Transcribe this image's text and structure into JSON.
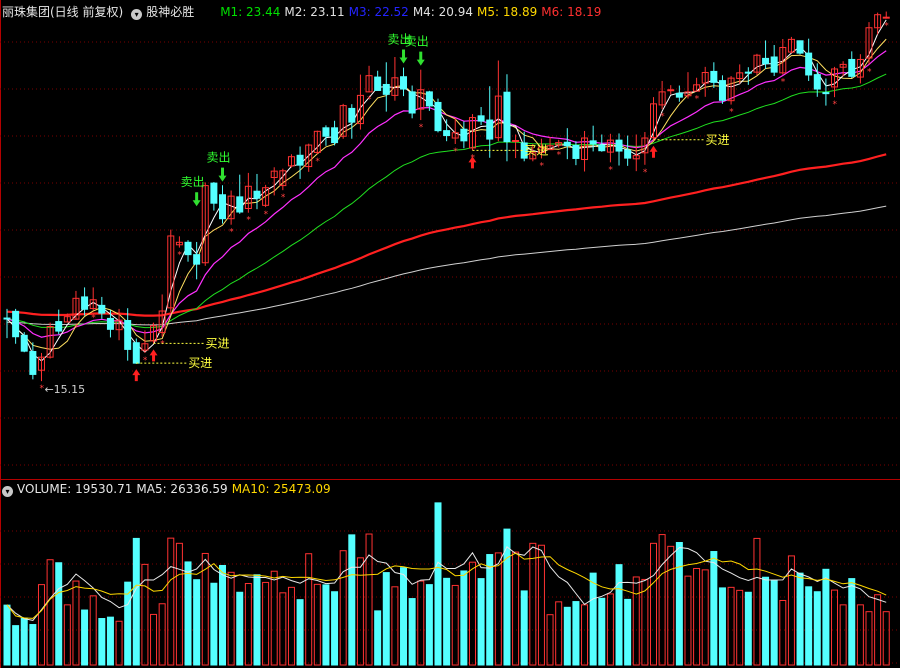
{
  "header": {
    "stock_title": "丽珠集团(日线 前复权)",
    "indicator_name": "股神必胜",
    "ma_labels": [
      {
        "text": "M1: 23.44",
        "color": "#00e000"
      },
      {
        "text": "M2: 23.11",
        "color": "#e0e0e0"
      },
      {
        "text": "M3: 22.52",
        "color": "#2424ff"
      },
      {
        "text": "M4: 20.94",
        "color": "#e0e0e0"
      },
      {
        "text": "M5: 18.89",
        "color": "#ffd800"
      },
      {
        "text": "M6: 18.19",
        "color": "#ff3030"
      }
    ]
  },
  "volume_header": {
    "volume": "VOLUME: 19530.71",
    "ma5": "MA5: 26336.59",
    "ma10": "MA10: 25473.09"
  },
  "colors": {
    "up": "#ff3232",
    "down": "#54ffff",
    "grid": "#7a0000",
    "buy_text": "#ffff40",
    "sell_text": "#30ff30"
  },
  "chart_data": [
    {
      "type": "candlestick",
      "price_range": [
        12.9,
        25.9
      ],
      "min_label": "15.15",
      "candles": [
        [
          17.44,
          17.42,
          17.7,
          16.87
        ],
        [
          17.63,
          16.91,
          17.7,
          16.71
        ],
        [
          16.95,
          16.5,
          17.04,
          16.47
        ],
        [
          16.49,
          15.84,
          16.75,
          15.7
        ],
        [
          15.96,
          16.33,
          16.45,
          15.65
        ],
        [
          16.33,
          17.2,
          17.31,
          16.29
        ],
        [
          17.34,
          17.07,
          17.68,
          16.98
        ],
        [
          17.33,
          17.48,
          17.57,
          17.31
        ],
        [
          17.41,
          18.0,
          18.21,
          17.39
        ],
        [
          18.04,
          17.69,
          18.31,
          17.51
        ],
        [
          17.71,
          17.96,
          18.31,
          17.66
        ],
        [
          17.8,
          17.58,
          18.04,
          17.42
        ],
        [
          17.43,
          17.12,
          17.67,
          16.89
        ],
        [
          17.11,
          17.38,
          17.7,
          16.81
        ],
        [
          17.37,
          16.55,
          17.72,
          16.23
        ],
        [
          16.74,
          16.16,
          16.86,
          16.14
        ],
        [
          16.53,
          16.71,
          17.09,
          16.45
        ],
        [
          16.79,
          17.22,
          17.31,
          16.72
        ],
        [
          17.03,
          17.64,
          18.11,
          16.91
        ],
        [
          17.73,
          19.77,
          19.95,
          17.61
        ],
        [
          19.52,
          19.59,
          19.76,
          19.44
        ],
        [
          19.59,
          19.24,
          19.65,
          19.04
        ],
        [
          19.24,
          18.97,
          19.6,
          18.54
        ],
        [
          19.01,
          21.2,
          21.29,
          18.92
        ],
        [
          21.27,
          20.7,
          21.3,
          20.49
        ],
        [
          20.94,
          20.26,
          21.21,
          20.12
        ],
        [
          20.26,
          20.9,
          21.06,
          20.09
        ],
        [
          20.88,
          20.45,
          21.51,
          20.4
        ],
        [
          20.55,
          21.18,
          21.56,
          20.43
        ],
        [
          21.04,
          20.84,
          21.53,
          20.53
        ],
        [
          20.64,
          21.14,
          21.22,
          20.59
        ],
        [
          21.43,
          21.61,
          21.72,
          20.92
        ],
        [
          21.2,
          21.62,
          21.68,
          21.07
        ],
        [
          21.76,
          22.02,
          22.09,
          21.71
        ],
        [
          22.06,
          21.78,
          22.31,
          21.39
        ],
        [
          21.74,
          22.35,
          22.39,
          21.59
        ],
        [
          22.14,
          22.74,
          22.76,
          22.09
        ],
        [
          22.84,
          22.6,
          22.91,
          22.33
        ],
        [
          22.84,
          22.42,
          23.04,
          22.34
        ],
        [
          22.6,
          23.47,
          23.52,
          22.53
        ],
        [
          23.39,
          23.0,
          23.51,
          22.53
        ],
        [
          22.96,
          23.76,
          24.35,
          22.79
        ],
        [
          23.86,
          24.32,
          24.6,
          23.85
        ],
        [
          24.28,
          23.9,
          24.46,
          23.9
        ],
        [
          24.07,
          23.79,
          24.7,
          23.3
        ],
        [
          23.76,
          24.26,
          24.85,
          23.61
        ],
        [
          24.29,
          23.94,
          24.55,
          23.74
        ],
        [
          23.86,
          23.26,
          24.04,
          23.11
        ],
        [
          23.37,
          23.92,
          24.49,
          23.06
        ],
        [
          23.86,
          23.46,
          23.89,
          23.32
        ],
        [
          23.56,
          22.76,
          23.67,
          22.71
        ],
        [
          22.76,
          22.62,
          23.08,
          22.46
        ],
        [
          22.55,
          22.7,
          23.12,
          22.38
        ],
        [
          22.8,
          22.47,
          23.02,
          22.26
        ],
        [
          22.27,
          23.13,
          23.23,
          22.2
        ],
        [
          23.18,
          23.03,
          23.43,
          22.92
        ],
        [
          23.06,
          22.52,
          24.02,
          21.99
        ],
        [
          22.56,
          23.74,
          24.75,
          22.46
        ],
        [
          23.85,
          22.45,
          24.36,
          21.89
        ],
        [
          22.46,
          22.48,
          22.65,
          21.98
        ],
        [
          22.41,
          21.98,
          22.73,
          21.89
        ],
        [
          21.96,
          22.13,
          22.38,
          21.89
        ],
        [
          22.14,
          22.29,
          22.53,
          21.97
        ],
        [
          22.22,
          22.33,
          22.58,
          22.21
        ],
        [
          22.35,
          22.42,
          22.5,
          22.28
        ],
        [
          22.43,
          22.33,
          22.83,
          21.95
        ],
        [
          22.34,
          21.97,
          22.46,
          21.78
        ],
        [
          21.94,
          22.55,
          22.75,
          21.6
        ],
        [
          22.47,
          22.38,
          22.9,
          22.17
        ],
        [
          22.35,
          22.19,
          22.65,
          22.16
        ],
        [
          22.15,
          22.49,
          22.67,
          21.86
        ],
        [
          22.49,
          22.18,
          22.68,
          21.77
        ],
        [
          22.21,
          21.98,
          22.62,
          21.76
        ],
        [
          21.96,
          22.05,
          22.65,
          21.61
        ],
        [
          22.13,
          22.55,
          22.72,
          21.79
        ],
        [
          22.56,
          23.52,
          23.71,
          22.5
        ],
        [
          23.49,
          23.86,
          24.17,
          23.37
        ],
        [
          23.9,
          23.92,
          24.05,
          23.79
        ],
        [
          23.82,
          23.71,
          24.04,
          23.58
        ],
        [
          23.75,
          23.86,
          24.42,
          23.67
        ],
        [
          23.88,
          24.06,
          24.26,
          23.87
        ],
        [
          24.11,
          24.41,
          24.57,
          23.72
        ],
        [
          24.44,
          24.13,
          24.7,
          23.97
        ],
        [
          24.18,
          23.62,
          24.33,
          23.52
        ],
        [
          23.61,
          24.25,
          24.31,
          23.5
        ],
        [
          24.24,
          24.4,
          24.64,
          24.09
        ],
        [
          24.42,
          24.41,
          24.56,
          24.06
        ],
        [
          24.42,
          24.9,
          24.94,
          24.34
        ],
        [
          24.81,
          24.66,
          25.32,
          24.51
        ],
        [
          24.85,
          24.42,
          25.19,
          24.31
        ],
        [
          24.4,
          25.12,
          25.36,
          24.35
        ],
        [
          24.99,
          25.35,
          25.42,
          24.96
        ],
        [
          25.31,
          24.96,
          25.32,
          24.92
        ],
        [
          24.96,
          24.34,
          25.37,
          24.17
        ],
        [
          24.35,
          23.94,
          24.67,
          23.72
        ],
        [
          23.84,
          23.81,
          24.24,
          23.47
        ],
        [
          24.0,
          24.51,
          24.57,
          23.71
        ],
        [
          24.56,
          24.64,
          24.73,
          24.3
        ],
        [
          24.78,
          24.3,
          25.01,
          24.25
        ],
        [
          24.28,
          24.78,
          24.93,
          24.1
        ],
        [
          24.82,
          25.68,
          25.84,
          24.64
        ],
        [
          25.68,
          26.05,
          26.11,
          25.49
        ],
        [
          25.96,
          25.98,
          26.14,
          25.94
        ]
      ],
      "overlay_lines": [
        "M1",
        "M2",
        "M3",
        "M4",
        "M5",
        "M6"
      ],
      "signals": [
        {
          "label": "买进",
          "i": 15,
          "price": 16.16
        },
        {
          "label": "买进",
          "i": 17,
          "price": 16.72
        },
        {
          "label": "买进",
          "i": 54,
          "price": 22.2
        },
        {
          "label": "买进",
          "i": 75,
          "price": 22.5
        },
        {
          "label": "卖出",
          "i": 22,
          "price": 20.5
        },
        {
          "label": "卖出",
          "i": 25,
          "price": 21.2
        },
        {
          "label": "卖出",
          "i": 46,
          "price": 24.55
        },
        {
          "label": "卖出",
          "i": 48,
          "price": 24.49
        }
      ]
    },
    {
      "type": "bar",
      "title": "VOLUME",
      "series": [
        {
          "name": "VOLUME",
          "values": [
            21900,
            14400,
            17100,
            14800,
            29400,
            38500,
            37400,
            22000,
            30700,
            20100,
            25300,
            17000,
            17500,
            16000,
            30300,
            46300,
            36800,
            18500,
            22400,
            46400,
            44500,
            37700,
            31200,
            40800,
            29900,
            36400,
            33900,
            26600,
            29800,
            33000,
            30200,
            34300,
            26400,
            28400,
            23900,
            40700,
            29500,
            29300,
            26800,
            41800,
            47600,
            39200,
            47900,
            19800,
            33800,
            28600,
            35600,
            24300,
            30700,
            29400,
            59300,
            31700,
            29100,
            34400,
            37600,
            31600,
            40400,
            41000,
            49700,
            41300,
            27100,
            44500,
            43800,
            18400,
            23100,
            21100,
            23200,
            22000,
            33600,
            24400,
            26000,
            36700,
            24000,
            32200,
            31300,
            44500,
            47700,
            43400,
            44800,
            32500,
            35300,
            34800,
            41500,
            28200,
            28400,
            27300,
            26600,
            46300,
            32100,
            30900,
            23600,
            39900,
            33600,
            28600,
            26800,
            35000,
            27400,
            22000,
            31600,
            22000,
            19500,
            25700,
            19500
          ]
        },
        {
          "name": "MA5",
          "values": [
            21990.88,
            18961.46,
            16968.59,
            16300.62,
            20223.15,
            24311.79,
            27914.3,
            29513.84,
            33269.54,
            30853.69,
            28153.97,
            24692.1,
            23215.56,
            20948.01,
            22089.42,
            28046.27,
            31131.4,
            31104.31,
            33045.76,
            36004.92,
            34985.03,
            33928.13,
            35123.79,
            38624.03,
            34913.55,
            32992.11,
            31744.04,
            32997.16,
            32186.4,
            32009.07,
            32005.82,
            31097.87,
            32164.32,
            30882.12,
            29904.15,
            31573.62,
            30895.42,
            29788.39,
            29998.1,
            34141.2,
            35769.85,
            35757.06,
            40245.06,
            37844.91,
            37256.1,
            33825.01,
            33096.09,
            29519.85,
            31062.06,
            31237.98,
            37574.04,
            35303.37,
            35301.58,
            37020.41,
            41031.26,
            35612.6,
            35429.59,
            37045.97,
            43218.74,
            40780.86,
            40117.24,
            43149.44,
            41922.46,
            35958.96,
            32219.85,
            30206.96,
            26136.42,
            22162.36,
            24223.06,
            25136.77,
            26560.24,
            30145.96,
            30208.95,
            29910.1,
            30891.23,
            32734.5,
            36703.03,
            40009.23,
            42976.35,
            42618.24,
            41076.69,
            37981.97,
            37468.63,
            35066.81,
            33617.46,
            31930.55,
            30905.36,
            32050.4,
            31130.43,
            31084.1,
            31127.14,
            35140.65,
            33331.82,
            32181.5,
            30568.58,
            31852.33,
            29952.83,
            28173.06,
            29006.27,
            27816.57,
            24997.8,
            24005.37,
            22929.94
          ]
        },
        {
          "name": "MA10",
          "values": [
            22037.85,
            17969.01,
            17208.63,
            17035.36,
            19848.05,
            24081.55,
            26526.75,
            27237.53,
            28659.35,
            28142.67,
            27908.73,
            27019.95,
            25829.45,
            26071.1,
            25945.49,
            29212.98,
            28939.95,
            26980.35,
            27298.62,
            31211.36,
            33186.91,
            33509.99,
            33151.21,
            35004.52,
            37091.04,
            33771.9,
            32640.7,
            32898.38,
            32915.78,
            32791.45,
            32496.31,
            31823.76,
            32418.9,
            32011.3,
            32106.6,
            32045.38,
            31446.36,
            30916.53,
            31163.44,
            32046.94,
            33066.25,
            32852.26,
            33011.39,
            33193.24,
            35175.96,
            36227.63,
            35905.28,
            35311.92,
            35122.12,
            35102.86,
            35707.13,
            34911.5,
            32658.13,
            32803.28,
            35169.63,
            37000.97,
            35829.8,
            36306.26,
            39159.51,
            40914.01,
            38734.46,
            39000.93,
            39506.77,
            39591.91,
            36580.44,
            34937.96,
            33521.4,
            31934.21,
            30077.1,
            28587.53,
            27805.19,
            27926.43,
            26979.44,
            25937.02,
            27099.14,
            30047.3,
            33436.89,
            34977.59,
            35887.75,
            36656.61,
            37136.3,
            38017.44,
            39064.89,
            37700.07,
            38045.34,
            36943.15,
            34908.75,
            35128.64,
            34294.57,
            33219.47,
            32129.58,
            32921.26,
            31889.7,
            31612.4,
            30958.57,
            31489.44,
            30591.63,
            29716.02,
            30131.6,
            29127.01,
            27962.82,
            27004.57,
            25573.69
          ]
        }
      ]
    }
  ]
}
